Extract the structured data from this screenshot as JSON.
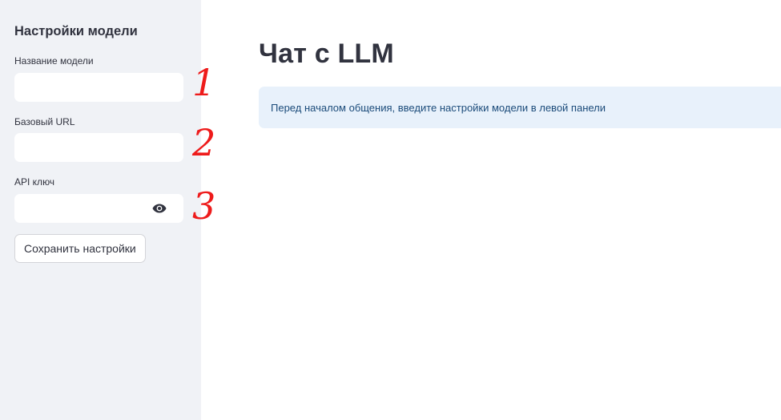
{
  "sidebar": {
    "title": "Настройки модели",
    "fields": [
      {
        "label": "Название модели",
        "value": "",
        "placeholder": "",
        "annotation": "1"
      },
      {
        "label": "Базовый URL",
        "value": "",
        "placeholder": "",
        "annotation": "2"
      },
      {
        "label": "API ключ",
        "value": "",
        "placeholder": "",
        "annotation": "3",
        "icon": "eye-icon"
      }
    ],
    "save_label": "Сохранить настройки"
  },
  "main": {
    "title": "Чат с LLM",
    "info": "Перед началом общения, введите настройки модели в левой панели"
  },
  "colors": {
    "sidebar_bg": "#f0f2f6",
    "info_bg": "#e8f1fb",
    "info_text": "#1b4b7a",
    "annotation": "#ee1b1b",
    "text": "#31333f"
  }
}
